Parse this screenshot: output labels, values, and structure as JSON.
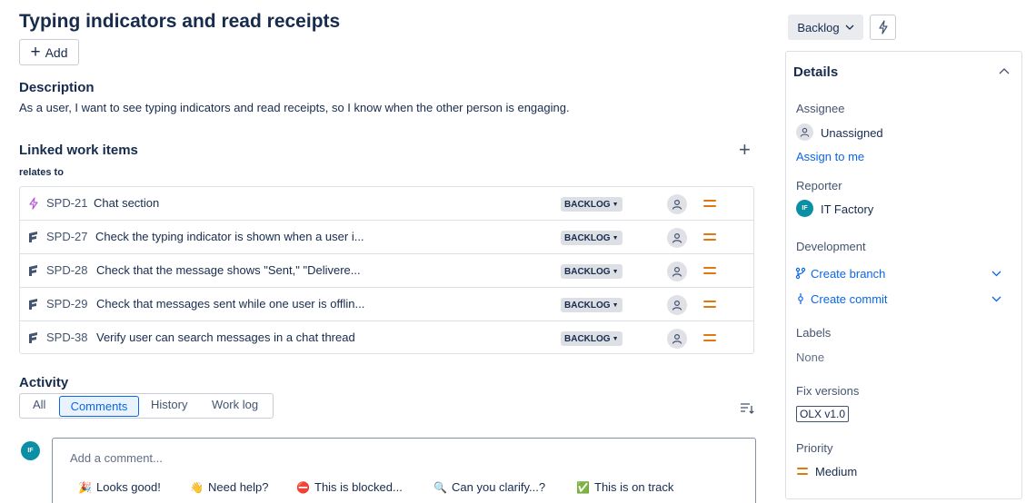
{
  "issue": {
    "title": "Typing indicators and read receipts",
    "add_label": "Add"
  },
  "description": {
    "heading": "Description",
    "text": "As a user, I want to see typing indicators and read receipts, so I know when the other person is engaging."
  },
  "linked": {
    "heading": "Linked work items",
    "relation": "relates to",
    "items": [
      {
        "key": "SPD-21",
        "summary": "Chat section",
        "status": "BACKLOG",
        "type_icon": "epic-lightning-icon"
      },
      {
        "key": "SPD-27",
        "summary": "Check the typing indicator is shown when a user i...",
        "status": "BACKLOG",
        "type_icon": "test-icon"
      },
      {
        "key": "SPD-28",
        "summary": "Check that the message shows \"Sent,\" \"Delivere...",
        "status": "BACKLOG",
        "type_icon": "test-icon"
      },
      {
        "key": "SPD-29",
        "summary": "Check that messages sent while one user is offlin...",
        "status": "BACKLOG",
        "type_icon": "test-icon"
      },
      {
        "key": "SPD-38",
        "summary": "Verify user can search messages in a chat thread",
        "status": "BACKLOG",
        "type_icon": "test-icon"
      }
    ]
  },
  "activity": {
    "heading": "Activity",
    "tabs": [
      "All",
      "Comments",
      "History",
      "Work log"
    ],
    "active_tab": "Comments",
    "avatar_initials": "IF",
    "comment_placeholder": "Add a comment...",
    "quick_replies": [
      {
        "emoji": "🎉",
        "label": "Looks good!"
      },
      {
        "emoji": "👋",
        "label": "Need help?"
      },
      {
        "emoji": "⛔",
        "label": "This is blocked..."
      },
      {
        "emoji": "🔍",
        "label": "Can you clarify...?"
      },
      {
        "emoji": "✅",
        "label": "This is on track"
      }
    ]
  },
  "status_button": {
    "label": "Backlog"
  },
  "details": {
    "heading": "Details",
    "assignee_label": "Assignee",
    "assignee_value": "Unassigned",
    "assign_to_me": "Assign to me",
    "reporter_label": "Reporter",
    "reporter_initials": "IF",
    "reporter_value": "IT Factory",
    "development_label": "Development",
    "create_branch": "Create branch",
    "create_commit": "Create commit",
    "labels_label": "Labels",
    "labels_value": "None",
    "fix_versions_label": "Fix versions",
    "fix_version_value": "OLX v1.0",
    "priority_label": "Priority",
    "priority_value": "Medium"
  },
  "colors": {
    "link": "#0c66e4",
    "priority_medium": "#e2770e",
    "avatar_teal": "#0b8fa4"
  }
}
